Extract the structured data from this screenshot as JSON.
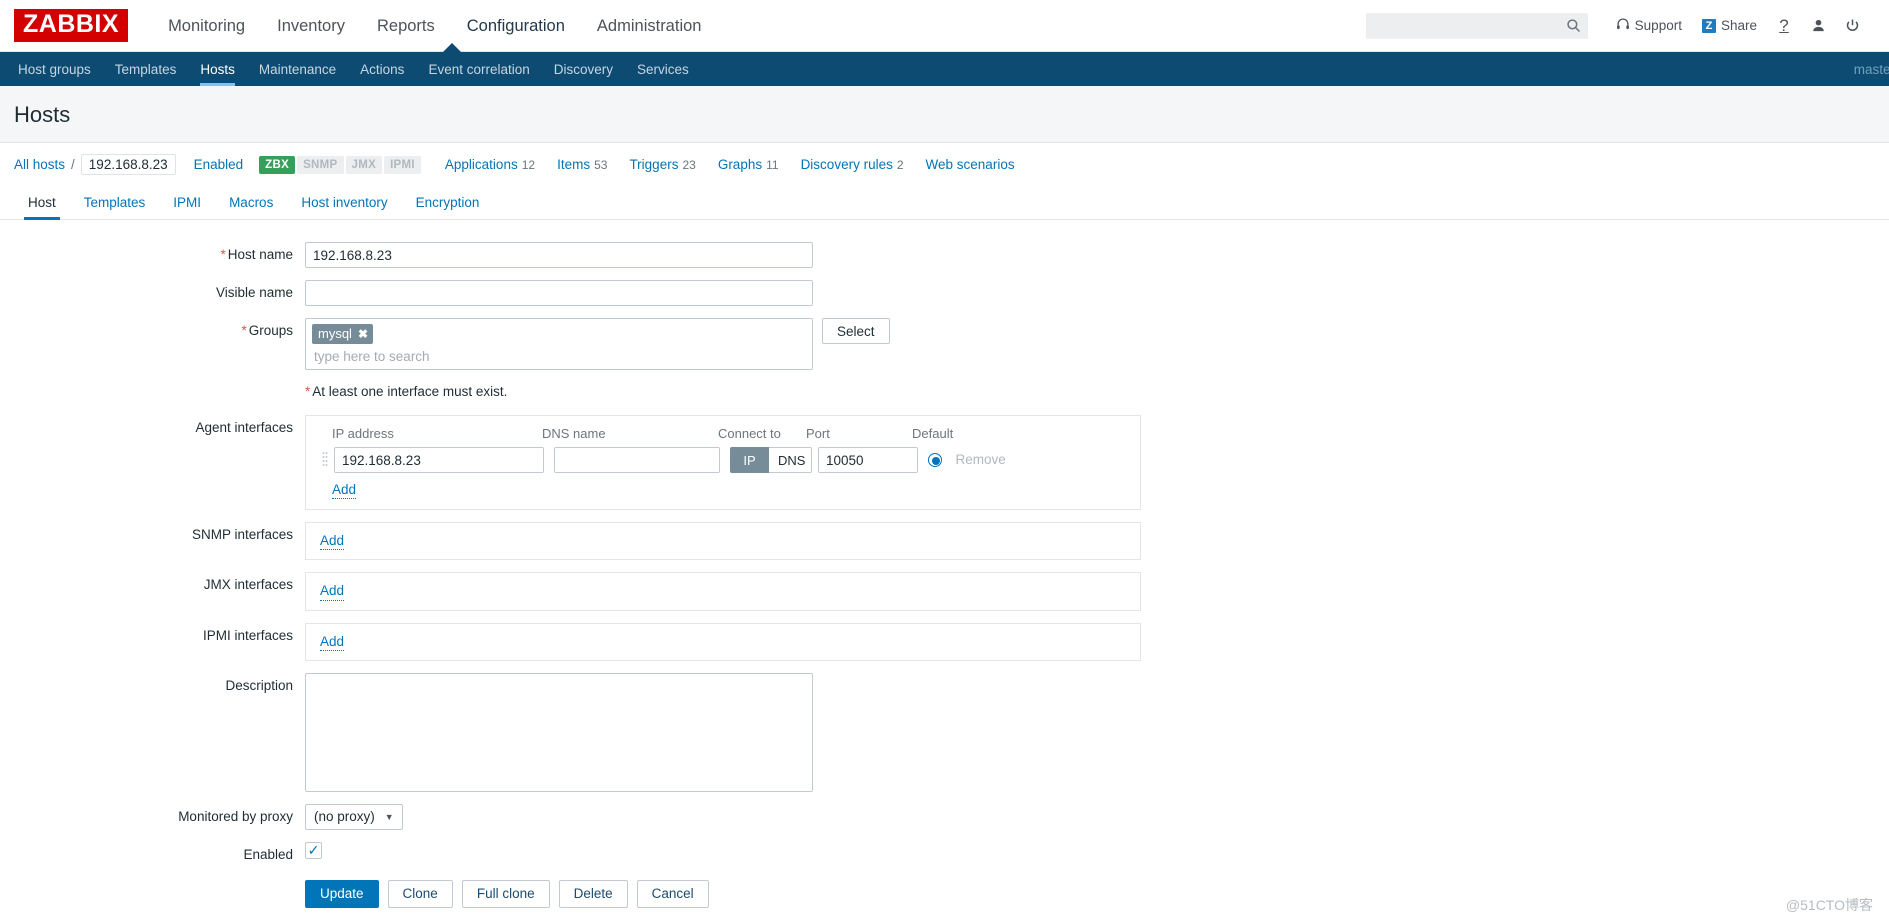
{
  "header": {
    "logo": "ZABBIX",
    "nav": [
      {
        "label": "Monitoring",
        "active": false
      },
      {
        "label": "Inventory",
        "active": false
      },
      {
        "label": "Reports",
        "active": false
      },
      {
        "label": "Configuration",
        "active": true
      },
      {
        "label": "Administration",
        "active": false
      }
    ],
    "search": {
      "value": "",
      "placeholder": ""
    },
    "support_label": "Support",
    "share_label": "Share",
    "share_glyph": "Z",
    "help_glyph": "?",
    "icons": [
      "search-icon",
      "headset-icon",
      "share-icon",
      "help-icon",
      "user-icon",
      "power-icon"
    ]
  },
  "subnav": {
    "items": [
      {
        "label": "Host groups",
        "active": false
      },
      {
        "label": "Templates",
        "active": false
      },
      {
        "label": "Hosts",
        "active": true
      },
      {
        "label": "Maintenance",
        "active": false
      },
      {
        "label": "Actions",
        "active": false
      },
      {
        "label": "Event correlation",
        "active": false
      },
      {
        "label": "Discovery",
        "active": false
      },
      {
        "label": "Services",
        "active": false
      }
    ],
    "server": "master"
  },
  "page": {
    "title": "Hosts"
  },
  "breadcrumb": {
    "all_hosts": "All hosts",
    "separator": "/",
    "host": "192.168.8.23",
    "status": "Enabled",
    "badges": [
      {
        "label": "ZBX",
        "state": "on"
      },
      {
        "label": "SNMP",
        "state": "off"
      },
      {
        "label": "JMX",
        "state": "off"
      },
      {
        "label": "IPMI",
        "state": "off"
      }
    ],
    "links": [
      {
        "label": "Applications",
        "count": "12"
      },
      {
        "label": "Items",
        "count": "53"
      },
      {
        "label": "Triggers",
        "count": "23"
      },
      {
        "label": "Graphs",
        "count": "11"
      },
      {
        "label": "Discovery rules",
        "count": "2"
      },
      {
        "label": "Web scenarios",
        "count": ""
      }
    ]
  },
  "tabs": [
    {
      "label": "Host",
      "active": true
    },
    {
      "label": "Templates",
      "active": false
    },
    {
      "label": "IPMI",
      "active": false
    },
    {
      "label": "Macros",
      "active": false
    },
    {
      "label": "Host inventory",
      "active": false
    },
    {
      "label": "Encryption",
      "active": false
    }
  ],
  "form": {
    "host_name": {
      "label": "Host name",
      "value": "192.168.8.23",
      "required": true
    },
    "visible_name": {
      "label": "Visible name",
      "value": "",
      "required": false
    },
    "groups": {
      "label": "Groups",
      "required": true,
      "chips": [
        "mysql"
      ],
      "chip_remove_glyph": "✖",
      "placeholder": "type here to search",
      "select_button": "Select"
    },
    "interface_note": "At least one interface must exist.",
    "agent_interfaces": {
      "label": "Agent interfaces",
      "columns": [
        "IP address",
        "DNS name",
        "Connect to",
        "Port",
        "Default"
      ],
      "rows": [
        {
          "ip": "192.168.8.23",
          "dns": "",
          "connect_to": "IP",
          "connect_options": [
            "IP",
            "DNS"
          ],
          "port": "10050",
          "default_selected": true,
          "remove_label": "Remove"
        }
      ],
      "add_label": "Add"
    },
    "snmp_interfaces": {
      "label": "SNMP interfaces",
      "add_label": "Add"
    },
    "jmx_interfaces": {
      "label": "JMX interfaces",
      "add_label": "Add"
    },
    "ipmi_interfaces": {
      "label": "IPMI interfaces",
      "add_label": "Add"
    },
    "description": {
      "label": "Description",
      "value": "",
      "placeholder": ""
    },
    "monitored_by_proxy": {
      "label": "Monitored by proxy",
      "value": "(no proxy)",
      "caret": "▼"
    },
    "enabled": {
      "label": "Enabled",
      "checked": true,
      "check_glyph": "✓"
    },
    "buttons": [
      {
        "label": "Update",
        "style": "primary"
      },
      {
        "label": "Clone",
        "style": "default"
      },
      {
        "label": "Full clone",
        "style": "default"
      },
      {
        "label": "Delete",
        "style": "default"
      },
      {
        "label": "Cancel",
        "style": "default"
      }
    ]
  },
  "watermark": "@51CTO博客",
  "colors": {
    "brand_red": "#d40000",
    "subnav_blue": "#0e4b72",
    "link_blue": "#0275b8",
    "status_green": "#34a05c",
    "chip_grey": "#768d99"
  }
}
